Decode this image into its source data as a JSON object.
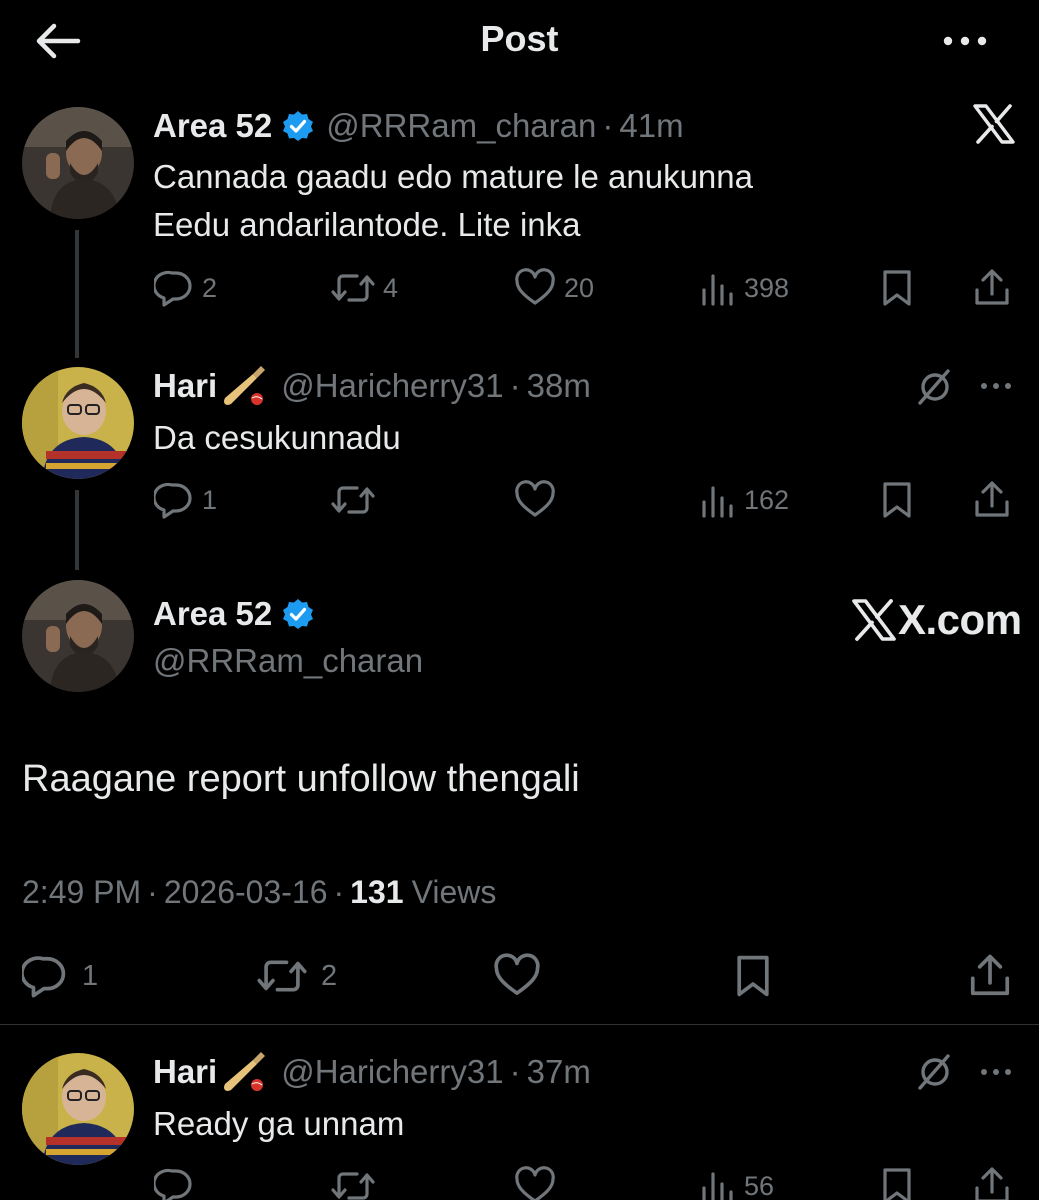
{
  "header": {
    "title": "Post",
    "back_icon": "arrow-left-icon",
    "more_icon": "more-horizontal-icon"
  },
  "reply1": {
    "name": "Area 52",
    "handle": "@RRRam_charan",
    "time": "41m",
    "lines": [
      "Cannada gaadu edo mature le anukunna",
      "Eedu andarilantode. Lite inka"
    ],
    "replies": "2",
    "reposts": "4",
    "likes": "20",
    "views": "398"
  },
  "reply2": {
    "name": "Hari",
    "handle": "@Haricherry31",
    "time": "38m",
    "text": "Da cesukunnadu",
    "replies": "1",
    "views": "162"
  },
  "main": {
    "name": "Area 52",
    "handle": "@RRRam_charan",
    "watermark": "X.com",
    "text": "Raagane report unfollow thengali",
    "time": "2:49 PM",
    "date": "2026-03-16",
    "views_count": "131",
    "views_label": "Views",
    "replies": "1",
    "reposts": "2"
  },
  "reply3": {
    "name": "Hari",
    "handle": "@Haricherry31",
    "time": "37m",
    "text": "Ready ga unnam",
    "views": "56"
  },
  "colors": {
    "background": "#000000",
    "text": "#e7e9ea",
    "muted": "#71767b",
    "verified": "#1d9bf0",
    "divider": "#2f3336"
  }
}
